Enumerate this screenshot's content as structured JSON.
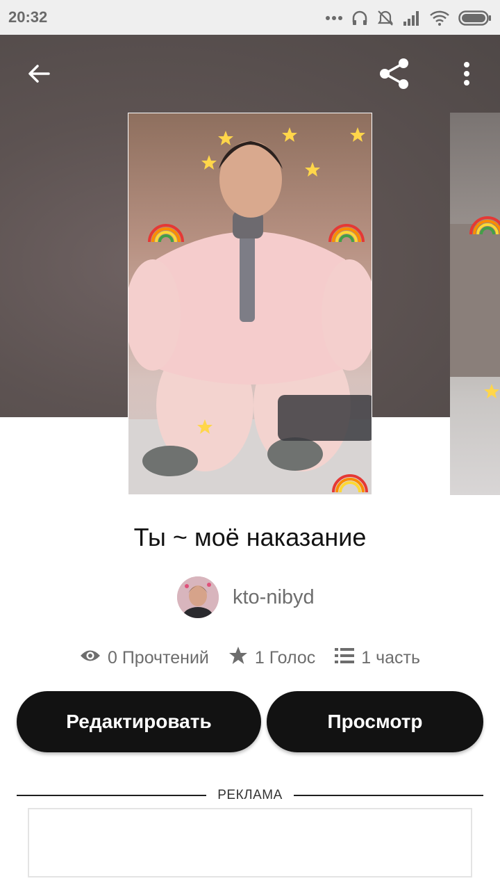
{
  "status_bar": {
    "time": "20:32",
    "icons": [
      "more-dots-icon",
      "headphones-icon",
      "alarm-off-icon",
      "signal-icon",
      "wifi-icon",
      "battery-icon"
    ]
  },
  "toolbar": {
    "back_icon": "arrow-left-icon",
    "share_icon": "share-icon",
    "more_icon": "more-vertical-icon"
  },
  "story": {
    "title": "Ты ~ моё наказание",
    "author": "kto-nibyd",
    "stats": {
      "reads": "0 Прочтений",
      "votes": "1 Голос",
      "parts": "1 часть"
    }
  },
  "actions": {
    "edit_label": "Редактировать",
    "view_label": "Просмотр"
  },
  "ad": {
    "label": "РЕКЛАМА"
  },
  "colors": {
    "accent": "#121212",
    "muted_text": "#6d6d6d",
    "hero_bg": "#5d5352",
    "statusbar_bg": "#efefef"
  }
}
